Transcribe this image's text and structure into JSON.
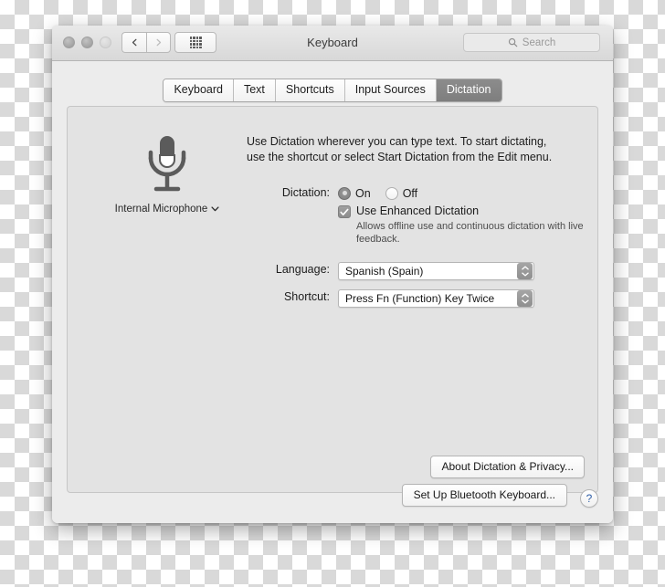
{
  "window": {
    "title": "Keyboard",
    "traffic_lights": [
      "close",
      "minimize",
      "zoom"
    ],
    "nav": {
      "back": "back-chevron",
      "forward": "forward-chevron"
    },
    "grid_button": "show-all-icon",
    "search": {
      "placeholder": "Search",
      "icon": "search-icon"
    }
  },
  "tabs": [
    {
      "label": "Keyboard",
      "selected": false
    },
    {
      "label": "Text",
      "selected": false
    },
    {
      "label": "Shortcuts",
      "selected": false
    },
    {
      "label": "Input Sources",
      "selected": false
    },
    {
      "label": "Dictation",
      "selected": true
    }
  ],
  "panel": {
    "microphone": {
      "icon": "microphone-icon",
      "label": "Internal Microphone",
      "disclosure": "chevron-down-icon"
    },
    "description": "Use Dictation wherever you can type text. To start dictating, use the shortcut or select Start Dictation from the Edit menu.",
    "dictation": {
      "label": "Dictation:",
      "options": [
        {
          "label": "On",
          "selected": true
        },
        {
          "label": "Off",
          "selected": false
        }
      ]
    },
    "enhanced": {
      "label": "Use Enhanced Dictation",
      "checked": true,
      "description": "Allows offline use and continuous dictation with live feedback."
    },
    "language": {
      "label": "Language:",
      "value": "Spanish (Spain)"
    },
    "shortcut": {
      "label": "Shortcut:",
      "value": "Press Fn (Function) Key Twice"
    },
    "about_button": "About Dictation & Privacy..."
  },
  "footer": {
    "bluetooth_button": "Set Up Bluetooth Keyboard...",
    "help_button": "?"
  }
}
